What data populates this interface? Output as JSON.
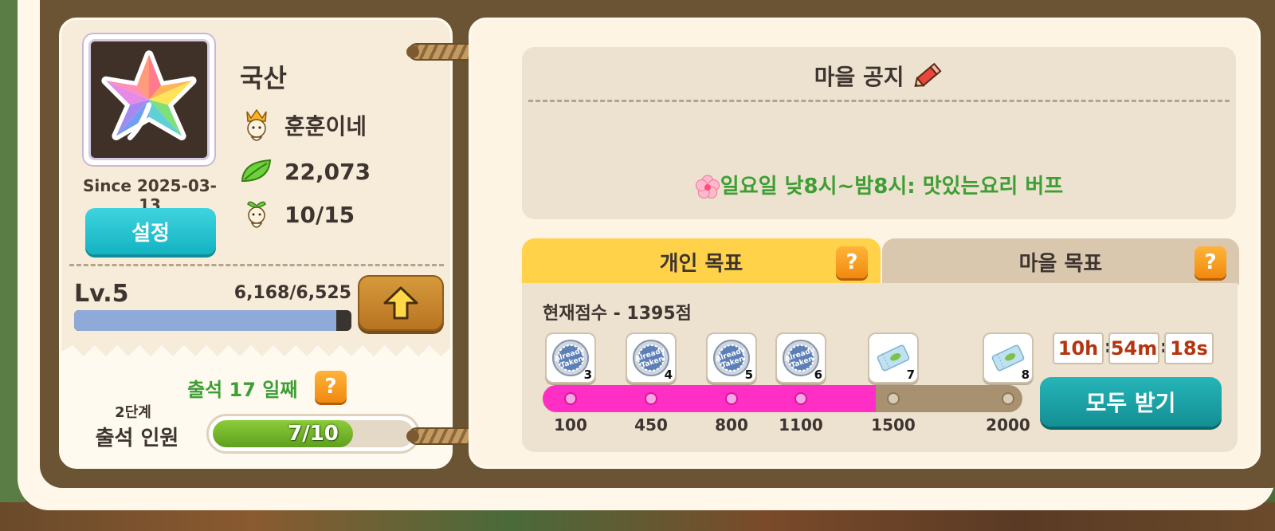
{
  "profile": {
    "village_name": "국산",
    "since": "Since 2025-03-13",
    "settings_label": "설정",
    "leader": "훈훈이네",
    "leaves": "22,073",
    "members": "10/15",
    "avatar_icon": "rainbow-leaf-icon"
  },
  "level": {
    "label": "Lv.5",
    "exp_text": "6,168/6,525",
    "exp_fraction": 0.945
  },
  "attendance": {
    "title": "출석 17 일째",
    "stage": "2단계",
    "label": "출석 인원",
    "progress_text": "7/10",
    "progress_fraction": 0.7
  },
  "notice": {
    "title": "마을 공지",
    "text": "일요일 낮8시~밤8시: 맛있는요리 버프"
  },
  "tabs": {
    "personal": "개인 목표",
    "village": "마을 목표",
    "help": "?"
  },
  "goal": {
    "score_text": "현재점수 - 1395점",
    "score_value": 1395,
    "milestones": [
      {
        "label": "100",
        "count": "3",
        "state": "taken"
      },
      {
        "label": "450",
        "count": "4",
        "state": "taken"
      },
      {
        "label": "800",
        "count": "5",
        "state": "taken"
      },
      {
        "label": "1100",
        "count": "6",
        "state": "taken"
      },
      {
        "label": "1500",
        "count": "7",
        "state": "ticket"
      },
      {
        "label": "2000",
        "count": "8",
        "state": "ticket"
      }
    ],
    "timer": {
      "h": "10h",
      "m": "54m",
      "s": "18s"
    },
    "claim_all": "모두 받기"
  },
  "colors": {
    "accent_green": "#3e9e34",
    "progress_pink": "#ff2ec4",
    "button_teal": "#13b3c2"
  }
}
